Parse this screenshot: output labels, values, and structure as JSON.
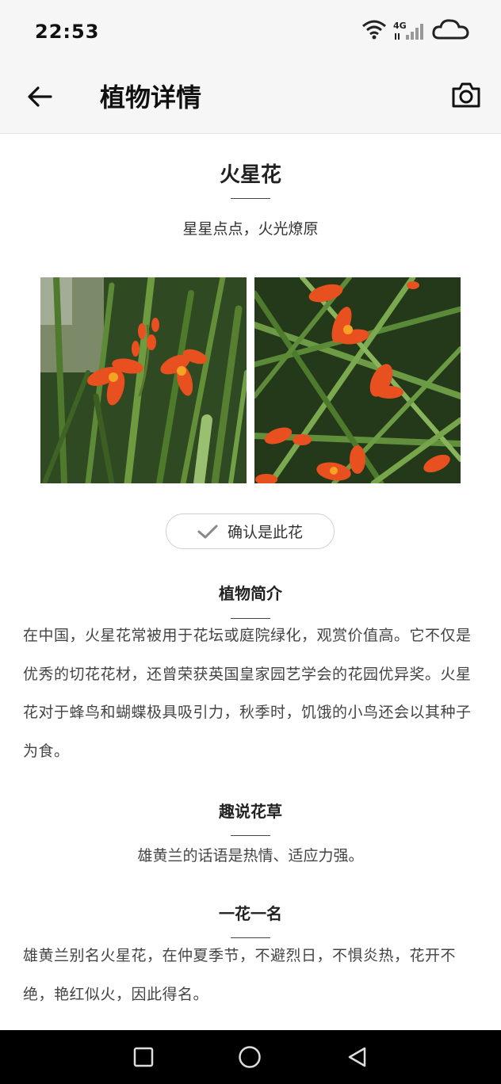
{
  "status_bar": {
    "time": "22:53",
    "network": "4G",
    "icons": [
      "wifi-icon",
      "signal-icon",
      "cloud-icon"
    ]
  },
  "app_bar": {
    "title": "植物详情",
    "back_icon": "arrow-left-icon",
    "camera_icon": "camera-icon"
  },
  "plant": {
    "name": "火星花",
    "tagline": "星星点点，火光燎原",
    "photos": [
      "flower-photo",
      "flower-photo"
    ]
  },
  "confirm_button": {
    "label": "确认是此花",
    "icon": "checkmark-icon"
  },
  "sections": [
    {
      "title": "植物简介",
      "text": "在中国，火星花常被用于花坛或庭院绿化，观赏价值高。它不仅是优秀的切花花材，还曾荣获英国皇家园艺学会的花园优异奖。火星花对于蜂鸟和蝴蝶极具吸引力，秋季时，饥饿的小鸟还会以其种子为食。"
    },
    {
      "title": "趣说花草",
      "text": "雄黄兰的话语是热情、适应力强。"
    },
    {
      "title": "一花一名",
      "text": "雄黄兰别名火星花，在仲夏季节，不避烈日，不惧炎热，花开不绝，艳红似火，因此得名。"
    }
  ],
  "nav_bar": {
    "icons": [
      "recent-apps-icon",
      "home-icon",
      "back-icon"
    ]
  },
  "colors": {
    "header_bg": "#f6f6f6",
    "text": "#222222",
    "nav_bg": "#000000",
    "flower_orange": "#e8501f"
  }
}
